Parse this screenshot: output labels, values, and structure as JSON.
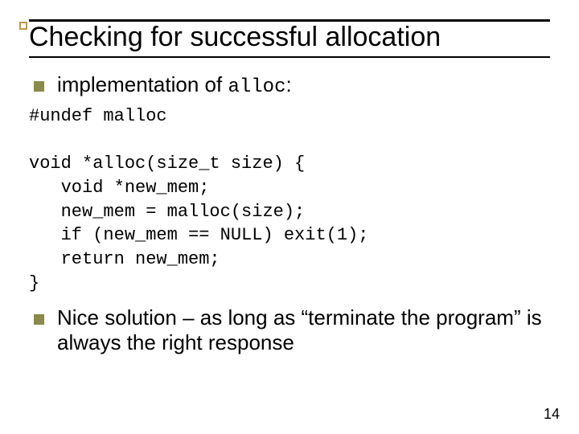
{
  "title": "Checking for successful allocation",
  "bullets": [
    {
      "prefix": "implementation of ",
      "mono": "alloc",
      "suffix": ":"
    },
    {
      "prefix": "Nice solution – as long as “terminate the program” is always the right response",
      "mono": "",
      "suffix": ""
    }
  ],
  "code_lines": [
    "#undef malloc",
    "",
    "void *alloc(size_t size) {",
    "   void *new_mem;",
    "   new_mem = malloc(size);",
    "   if (new_mem == NULL) exit(1);",
    "   return new_mem;",
    "}"
  ],
  "page_number": "14"
}
